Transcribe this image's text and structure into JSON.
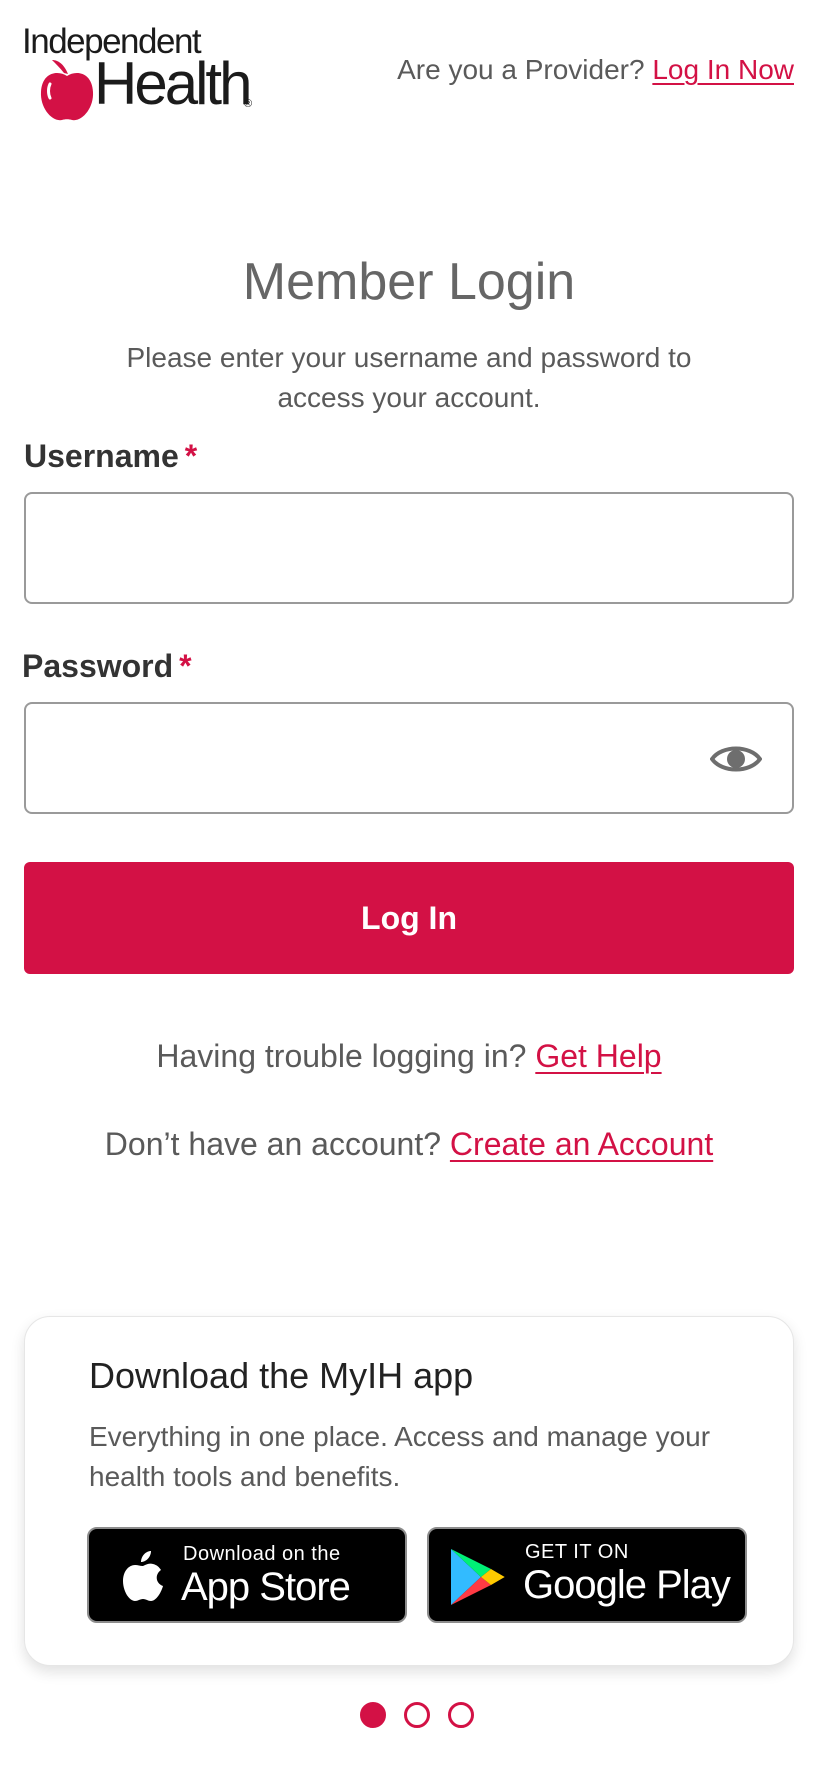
{
  "header": {
    "logo_line1": "Independent",
    "logo_line2": "Health",
    "logo_reg": "®",
    "provider_prompt": "Are you a Provider?",
    "provider_link": "Log In Now"
  },
  "login": {
    "title": "Member Login",
    "subtitle": "Please enter your username and password to access your account.",
    "username_label": "Username",
    "username_value": "",
    "password_label": "Password",
    "password_value": "",
    "required_mark": "*",
    "submit_label": "Log In",
    "help_prompt": "Having trouble logging in?",
    "help_link": "Get Help",
    "account_prompt": "Don’t have an account?",
    "account_link": "Create an Account"
  },
  "app_promo": {
    "title": "Download the MyIH app",
    "text": "Everything in one place. Access and manage your health tools and benefits.",
    "app_store_small": "Download on the",
    "app_store_big": "App Store",
    "google_small": "GET IT ON",
    "google_big": "Google Play"
  },
  "carousel": {
    "count": 3,
    "active_index": 0
  },
  "colors": {
    "brand": "#d31145",
    "text": "#5a5a5a",
    "border": "#9a9a9a"
  },
  "icons": [
    "apple-logo-icon",
    "eye-icon",
    "apple-store-icon",
    "google-play-icon"
  ]
}
